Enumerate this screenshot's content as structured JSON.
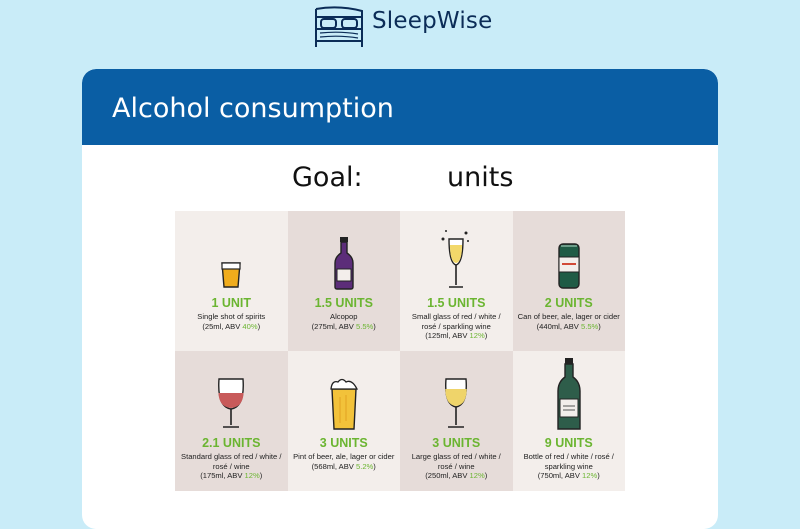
{
  "brand": {
    "name": "SleepWise",
    "logo_icon": "bed-icon"
  },
  "card": {
    "title": "Alcohol consumption"
  },
  "goal": {
    "label": "Goal:",
    "value": "",
    "units_label": "units"
  },
  "colors": {
    "background": "#c9ecf8",
    "header": "#0a5ea4",
    "units_green": "#6bb531",
    "tile_light": "#f3eeeb",
    "tile_dark": "#e6dcd9"
  },
  "drinks": [
    {
      "icon": "shot-glass-icon",
      "units": "1 UNIT",
      "desc": "Single shot of spirits",
      "detail": "(25ml, ABV ",
      "abv": "40%",
      "close": ")"
    },
    {
      "icon": "alcopop-bottle-icon",
      "units": "1.5 UNITS",
      "desc": "Alcopop",
      "detail": "(275ml, ABV ",
      "abv": "5.5%",
      "close": ")"
    },
    {
      "icon": "champagne-glass-icon",
      "units": "1.5 UNITS",
      "desc": "Small glass of red / white / rosé / sparkling wine",
      "detail": "(125ml, ABV ",
      "abv": "12%",
      "close": ")"
    },
    {
      "icon": "beer-can-icon",
      "units": "2 UNITS",
      "desc": "Can of beer, ale, lager or cider",
      "detail": "(440ml, ABV ",
      "abv": "5.5%",
      "close": ")"
    },
    {
      "icon": "red-wine-glass-icon",
      "units": "2.1 UNITS",
      "desc": "Standard glass of red / white / rosé / wine",
      "detail": "(175ml, ABV ",
      "abv": "12%",
      "close": ")"
    },
    {
      "icon": "beer-pint-icon",
      "units": "3 UNITS",
      "desc": "Pint of beer, ale, lager or cider",
      "detail": "(568ml, ABV ",
      "abv": "5.2%",
      "close": ")"
    },
    {
      "icon": "white-wine-glass-icon",
      "units": "3 UNITS",
      "desc": "Large glass of red / white / rosé / wine",
      "detail": "(250ml, ABV ",
      "abv": "12%",
      "close": ")"
    },
    {
      "icon": "wine-bottle-icon",
      "units": "9 UNITS",
      "desc": "Bottle of red / white / rosé / sparkling wine",
      "detail": "(750ml, ABV ",
      "abv": "12%",
      "close": ")"
    }
  ]
}
